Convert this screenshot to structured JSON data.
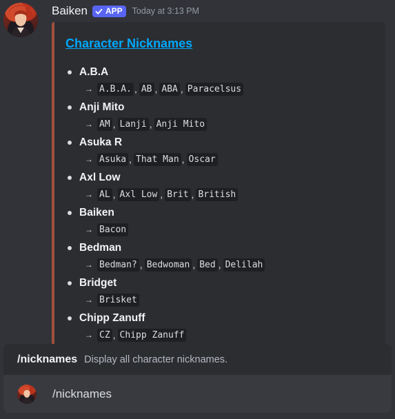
{
  "message": {
    "username": "Baiken",
    "badge": "APP",
    "timestamp": "Today at 3:13 PM",
    "embed": {
      "accent_color": "#a0503c",
      "title": "Character Nicknames",
      "characters": [
        {
          "name": "A.B.A",
          "nicknames": [
            "A.B.A.",
            "AB",
            "ABA",
            "Paracelsus"
          ]
        },
        {
          "name": "Anji Mito",
          "nicknames": [
            "AM",
            "Lanji",
            "Anji Mito"
          ]
        },
        {
          "name": "Asuka R",
          "nicknames": [
            "Asuka",
            "That Man",
            "Oscar"
          ]
        },
        {
          "name": "Axl Low",
          "nicknames": [
            "AL",
            "Axl Low",
            "Brit",
            "British"
          ]
        },
        {
          "name": "Baiken",
          "nicknames": [
            "Bacon"
          ]
        },
        {
          "name": "Bedman",
          "nicknames": [
            "Bedman?",
            "Bedwoman",
            "Bed",
            "Delilah"
          ]
        },
        {
          "name": "Bridget",
          "nicknames": [
            "Brisket"
          ]
        },
        {
          "name": "Chipp Zanuff",
          "nicknames": [
            "CZ",
            "Chipp Zanuff"
          ]
        }
      ]
    }
  },
  "command_suggestion": {
    "name": "/nicknames",
    "description": "Display all character nicknames."
  },
  "input": {
    "value": "/nicknames"
  },
  "colors": {
    "background": "#313338",
    "embed_background": "#2b2d31",
    "link": "#00a8fc",
    "badge": "#5865f2",
    "input_background": "#383a40"
  },
  "icons": {
    "avatar": "baiken-avatar",
    "badge_check": "checkmark-icon",
    "arrow": "right-arrow-icon",
    "bullet": "bullet-icon"
  }
}
